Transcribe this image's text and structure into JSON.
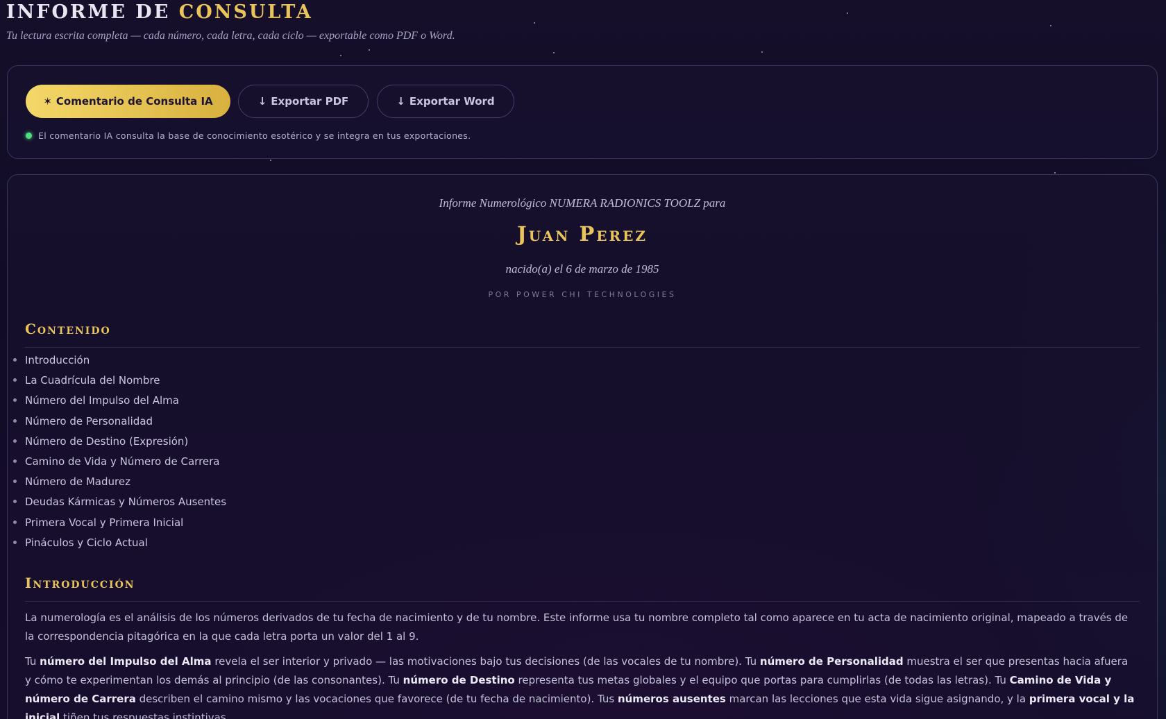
{
  "header": {
    "title_part1": "INFORME DE",
    "title_part2": "CONSULTA",
    "subtitle": "Tu lectura escrita completa — cada número, cada letra, cada ciclo — exportable como PDF o Word."
  },
  "toolbar": {
    "ai_button": {
      "icon": "✶",
      "icon_name": "sparkle-icon",
      "label": "Comentario de Consulta IA"
    },
    "pdf_button": {
      "icon": "↓",
      "icon_name": "download-icon",
      "label": "Exportar PDF"
    },
    "word_button": {
      "icon": "↓",
      "icon_name": "download-icon",
      "label": "Exportar Word"
    },
    "status_note": "El comentario IA consulta la base de conocimiento esotérico y se integra en tus exportaciones.",
    "status_color": "#4ee07c"
  },
  "report": {
    "pre_title": "Informe Numerológico NUMERA RADIONICS TOOLZ para",
    "name": "Juan Perez",
    "birth": "nacido(a) el 6 de marzo de 1985",
    "by": "POR POWER CHI TECHNOLOGIES",
    "toc_title": "Contenido",
    "toc": [
      "Introducción",
      "La Cuadrícula del Nombre",
      "Número del Impulso del Alma",
      "Número de Personalidad",
      "Número de Destino (Expresión)",
      "Camino de Vida y Número de Carrera",
      "Número de Madurez",
      "Deudas Kármicas y Números Ausentes",
      "Primera Vocal y Primera Inicial",
      "Pináculos y Ciclo Actual"
    ],
    "intro_title": "Introducción",
    "intro_p1": "La numerología es el análisis de los números derivados de tu fecha de nacimiento y de tu nombre. Este informe usa tu nombre completo tal como aparece en tu acta de nacimiento original, mapeado a través de la correspondencia pitagórica en la que cada letra porta un valor del 1 al 9.",
    "intro_p2": {
      "t1": "Tu ",
      "b1": "número del Impulso del Alma",
      "t2": " revela el ser interior y privado — las motivaciones bajo tus decisiones (de las vocales de tu nombre). Tu ",
      "b2": "número de Personalidad",
      "t3": " muestra el ser que presentas hacia afuera y cómo te experimentan los demás al principio (de las consonantes). Tu ",
      "b3": "número de Destino",
      "t4": " representa tus metas globales y el equipo que portas para cumplirlas (de todas las letras). Tu ",
      "b4": "Camino de Vida y número de Carrera",
      "t5": " describen el camino mismo y las vocaciones que favorece (de tu fecha de nacimiento). Tus ",
      "b5": "números ausentes",
      "t6": " marcan las lecciones que esta vida sigue asignando, y la ",
      "b6": "primera vocal y la inicial",
      "t7": " tiñen tus respuestas instintivas."
    }
  },
  "colors": {
    "accent_gold": "#e8c45b",
    "background": "#150f2a"
  }
}
